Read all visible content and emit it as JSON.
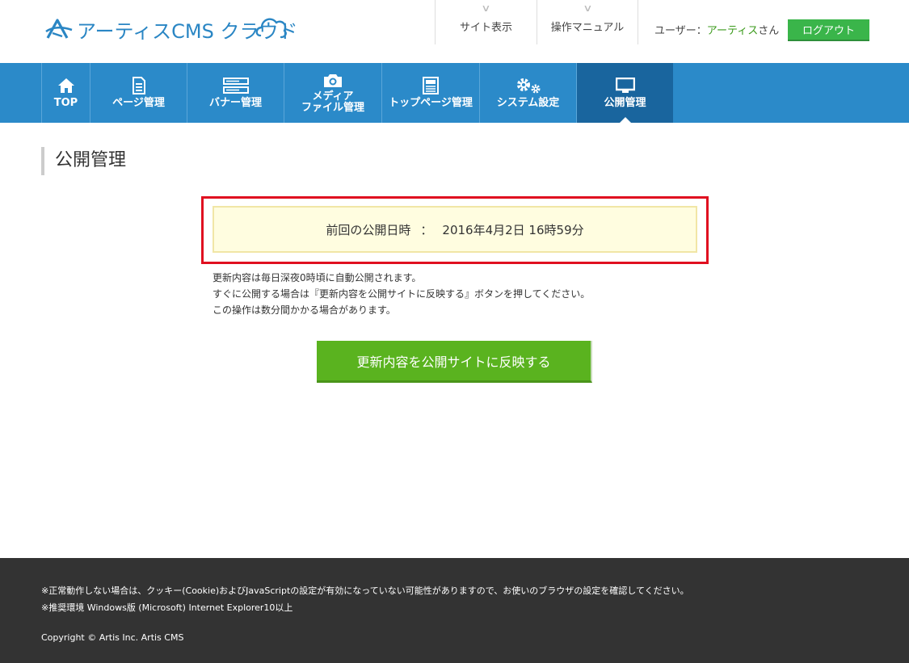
{
  "header": {
    "logo_text": "アーティスCMS クラウド",
    "site_view": "サイト表示",
    "manual": "操作マニュアル",
    "user_label": "ユーザー：",
    "user_name": "アーティス",
    "user_suffix": "さん",
    "logout": "ログアウト"
  },
  "nav": {
    "items": [
      {
        "icon": "home-icon",
        "label": "TOP"
      },
      {
        "icon": "document-icon",
        "label": "ページ管理"
      },
      {
        "icon": "banner-icon",
        "label": "バナー管理"
      },
      {
        "icon": "camera-icon",
        "label1": "メディア",
        "label2": "ファイル管理"
      },
      {
        "icon": "newspaper-icon",
        "label": "トップページ管理"
      },
      {
        "icon": "gears-icon",
        "label": "システム設定"
      },
      {
        "icon": "monitor-icon",
        "label": "公開管理"
      }
    ],
    "active_index": 6
  },
  "main": {
    "title": "公開管理",
    "last_publish_label": "前回の公開日時",
    "last_publish_sep": "：",
    "last_publish_value": "2016年4月2日 16時59分",
    "notes": [
      "更新内容は毎日深夜0時頃に自動公開されます。",
      "すぐに公開する場合は『更新内容を公開サイトに反映する』ボタンを押してください。",
      "この操作は数分間かかる場合があります。"
    ],
    "publish_button": "更新内容を公開サイトに反映する"
  },
  "footer": {
    "note1": "※正常動作しない場合は、クッキー(Cookie)およびJavaScriptの設定が有効になっていない可能性がありますので、お使いのブラウザの設定を確認してください。",
    "note2": "※推奨環境 Windows版 (Microsoft) Internet Explorer10以上",
    "copyright": "Copyright © Artis Inc. Artis CMS"
  },
  "colors": {
    "nav_bg": "#2b8ac9",
    "nav_active": "#19659e",
    "logout_green": "#3ab54a",
    "publish_green": "#5ab31f",
    "highlight_red": "#e01020",
    "info_bg": "#fffde0",
    "footer_bg": "#333333"
  }
}
